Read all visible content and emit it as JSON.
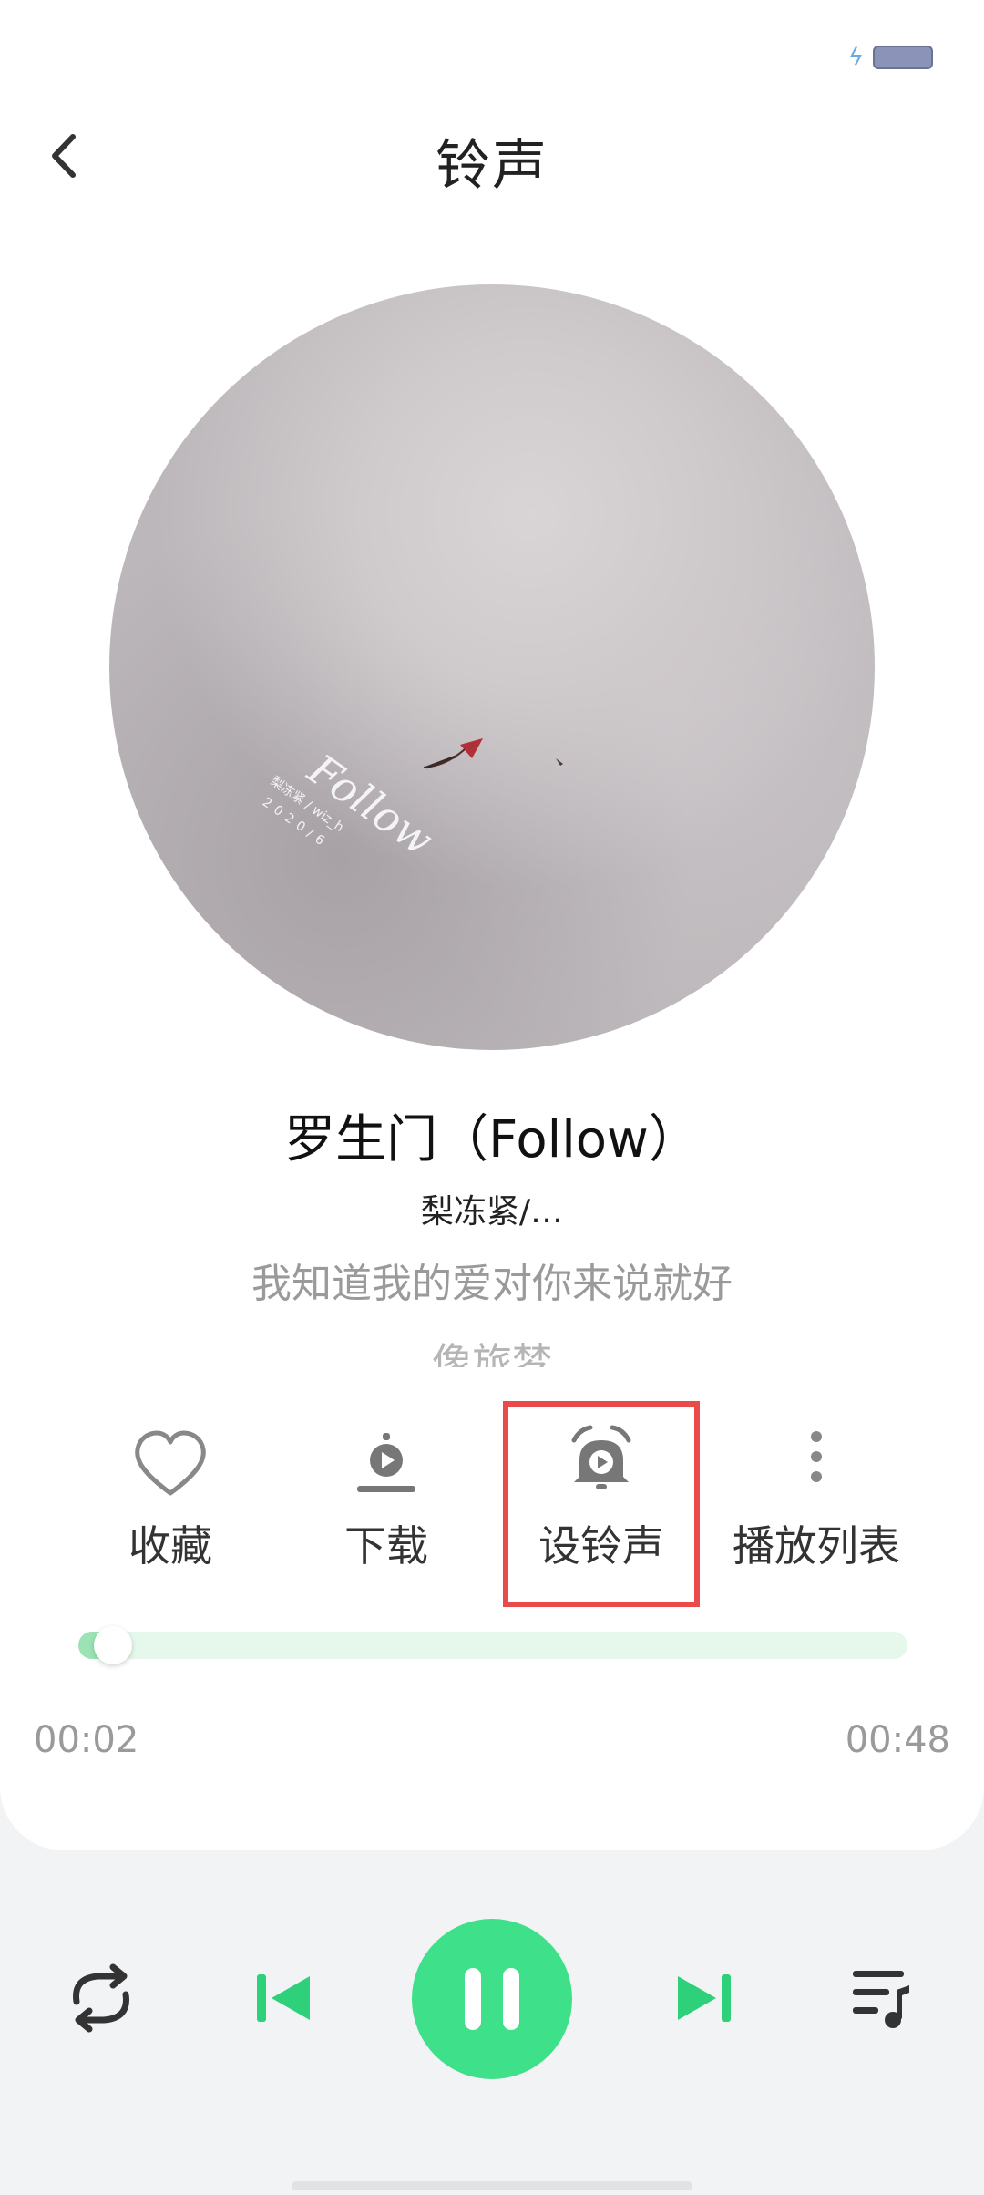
{
  "header": {
    "title": "铃声"
  },
  "track": {
    "name": "罗生门（Follow）",
    "artist": "梨冻紧/…",
    "lyric_current": "我知道我的爱对你来说就好",
    "lyric_next": "像旅梦"
  },
  "cover": {
    "title_text": "Follow",
    "sub_text_1": "梨冻紧 / wiz_h",
    "sub_text_2": "2020/6"
  },
  "actions": [
    {
      "label": "收藏",
      "icon": "heart-icon"
    },
    {
      "label": "下载",
      "icon": "download-icon"
    },
    {
      "label": "设铃声",
      "icon": "alarm-bell-icon"
    },
    {
      "label": "播放列表",
      "icon": "more-vertical-icon"
    }
  ],
  "progress": {
    "current": "00:02",
    "total": "00:48",
    "fraction": 0.042
  },
  "colors": {
    "accent": "#3fe08a",
    "highlight": "#e94b4b"
  },
  "controls": [
    "repeat-icon",
    "previous-icon",
    "pause-icon",
    "next-icon",
    "playlist-icon"
  ]
}
